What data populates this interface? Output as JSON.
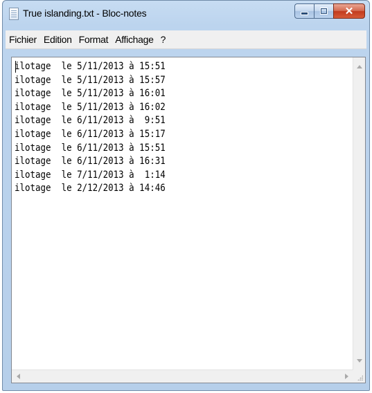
{
  "window": {
    "title": "True islanding.txt - Bloc-notes",
    "icon": "notepad-icon",
    "buttons": {
      "minimize": "minimize-icon",
      "maximize": "maximize-icon",
      "close": "✕"
    }
  },
  "menu": {
    "items": [
      "Fichier",
      "Edition",
      "Format",
      "Affichage",
      "?"
    ]
  },
  "document": {
    "lines": [
      "ilotage  le 5/11/2013 à 15:51",
      "ilotage  le 5/11/2013 à 15:57",
      "ilotage  le 5/11/2013 à 16:01",
      "ilotage  le 5/11/2013 à 16:02",
      "ilotage  le 6/11/2013 à  9:51",
      "ilotage  le 6/11/2013 à 15:17",
      "ilotage  le 6/11/2013 à 15:51",
      "ilotage  le 6/11/2013 à 16:31",
      "ilotage  le 7/11/2013 à  1:14",
      "ilotage  le 2/12/2013 à 14:46"
    ]
  },
  "colors": {
    "titlebar": "#bcd4ee",
    "close_button": "#c23b1d",
    "menubar": "#f0f0f0"
  }
}
